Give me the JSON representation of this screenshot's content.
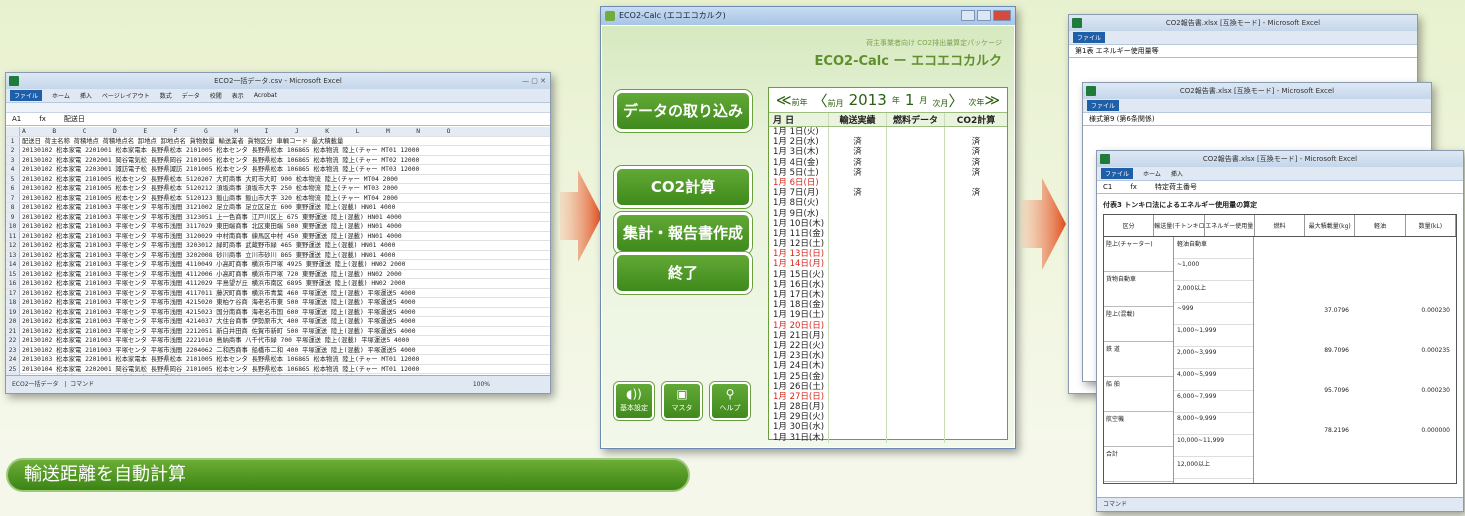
{
  "left_window": {
    "title": "ECO2一括データ.csv - Microsoft Excel",
    "ribbon": [
      "ファイル",
      "ホーム",
      "挿入",
      "ページレイアウト",
      "数式",
      "データ",
      "校閲",
      "表示",
      "Acrobat"
    ],
    "cell_ref": "A1",
    "formula": "配送日",
    "rows": [
      "配送日 荷主名称 荷積地点 荷積地点名 卸地点 卸地点名 貨物数量 輸送業者 貨物区分 車輌コード 最大積載量",
      "20130102 松本家電 2201001 松本家電本 長野県松本 2101005 松本センタ 長野県松本 106865 松本物流 陸上(チャー MT01 12000",
      "20130102 松本家電 2202001 岡谷電気松 長野県岡谷 2101005 松本センタ 長野県松本 106865 松本物流 陸上(チャー MT02 12000",
      "20130102 松本家電 2203001 諏訪電子松 長野県諏訪 2101005 松本センタ 長野県松本 106865 松本物流 陸上(チャー MT03 12000",
      "20130102 松本家電 2101005 松本センタ 長野県松本 5120207 大町商事 大町市大町 900 松本物流 陸上(チャー MT04 2000",
      "20130102 松本家電 2101005 松本センタ 長野県松本 5120212 須坂商事 須坂市大字 250 松本物流 陸上(チャー MT03 2000",
      "20130102 松本家電 2101005 松本センタ 長野県松本 5120123 飯山商事 飯山市大字 320 松本物流 陸上(チャー MT04 2000",
      "20130102 松本家電 2101003 平塚センタ 平塚市浅間 3121002 足立商事 足立区足立 600 東野運送 陸上(混載) HN01 4000",
      "20130102 松本家電 2101003 平塚センタ 平塚市浅間 3123051 上一色商事 江戸川区上 675 東野運送 陸上(混載) HN01 4000",
      "20130102 松本家電 2101003 平塚センタ 平塚市浅間 3117029 東田端商事 北区東田端 500 東野運送 陸上(混載) HN01 4000",
      "20130102 松本家電 2101003 平塚センタ 平塚市浅間 3120029 中村南商事 練馬区中村 450 東野運送 陸上(混載) HN01 4000",
      "20130102 松本家電 2101003 平塚センタ 平塚市浅間 3203012 緑町商事 武蔵野市緑 465 東野運送 陸上(混載) HN01 4000",
      "20130102 松本家電 2101003 平塚センタ 平塚市浅間 3202008 砂川商事 立川市砂川 865 東野運送 陸上(混載) HN01 4000",
      "20130102 松本家電 2101003 平塚センタ 平塚市浅間 4110049 小高町商事 横浜市戸塚 4925 東野運送 陸上(混載) HN02 2000",
      "20130102 松本家電 2101003 平塚センタ 平塚市浅間 4112006 小高町商事 横浜市戸塚 720 東野運送 陸上(混載) HN02 2000",
      "20130102 松本家電 2101003 平塚センタ 平塚市浅間 4112029 平島望が丘 横浜市南区 6895 東野運送 陸上(混載) HN02 2000",
      "20130102 松本家電 2101003 平塚センタ 平塚市浅間 4117011 藤沢町商事 横浜市青葉 460 平塚運送 陸上(混載) 平塚運送5 4000",
      "20130102 松本家電 2101003 平塚センタ 平塚市浅間 4215020 東柏ケ谷商 海老名市東 500 平塚運送 陸上(混載) 平塚運送5 4000",
      "20130102 松本家電 2101003 平塚センタ 平塚市浅間 4215023 国分南商事 海老名市国 600 平塚運送 陸上(混載) 平塚運送5 4000",
      "20130102 松本家電 2101003 平塚センタ 平塚市浅間 4214037 大住台商事 伊勢原市大 400 平塚運送 陸上(混載) 平塚運送5 4000",
      "20130102 松本家電 2101003 平塚センタ 平塚市浅間 2212051 新白井田商 佐賀市新町 500 平塚運送 陸上(混載) 平塚運送5 4000",
      "20130102 松本家電 2101003 平塚センタ 平塚市浅間 2221010 島納商事 八千代市緑 700 平塚運送 陸上(混載) 平塚運送5 4000",
      "20130102 松本家電 2101003 平塚センタ 平塚市浅間 2204062 二和西商事 船橋市二和 400 平塚運送 陸上(混載) 平塚運送5 4000",
      "20130103 松本家電 2201001 松本家電本 長野県松本 2101005 松本センタ 長野県松本 106865 松本物流 陸上(チャー MT01 12000",
      "20130104 松本家電 2202001 岡谷電気松 長野県岡谷 2101005 松本センタ 長野県松本 106865 松本物流 陸上(チャー MT01 12000",
      "20130105 松本家電 2201001 松本家電本 長野県松本 2101005 松本センタ 長野県松本 106865 松本物流 陸上(チャー MT01 12000"
    ],
    "sheet_tab": "ECO2一括データ",
    "status": "コマンド",
    "zoom": "100%"
  },
  "app": {
    "title": "ECO2-Calc (エコエコカルク)",
    "subtitle": "荷主事業者向け CO2排出量算定パッケージ",
    "heading": "ECO2-Calc ー エコエコカルク",
    "menu": [
      "データの取り込み",
      "CO2計算",
      "集計・報告書作成",
      "終了"
    ],
    "small_buttons": [
      {
        "label": "基本設定",
        "icon": "speaker-icon"
      },
      {
        "label": "マスタ",
        "icon": "camera-icon"
      },
      {
        "label": "ヘルプ",
        "icon": "magnifier-icon"
      }
    ],
    "nav": {
      "prev_year": "前年",
      "prev_month": "前月",
      "year": "2013",
      "year_unit": "年",
      "month": "1",
      "month_unit": "月",
      "next_month": "次月",
      "next_year": "次年"
    },
    "columns": [
      "月 日",
      "輸送実績",
      "燃料データ",
      "CO2計算"
    ],
    "days": [
      {
        "d": "1月 1日(火)",
        "a": "",
        "b": "",
        "c": "",
        "red": false
      },
      {
        "d": "1月 2日(水)",
        "a": "済",
        "b": "",
        "c": "済",
        "red": false
      },
      {
        "d": "1月 3日(木)",
        "a": "済",
        "b": "",
        "c": "済",
        "red": false
      },
      {
        "d": "1月 4日(金)",
        "a": "済",
        "b": "",
        "c": "済",
        "red": false
      },
      {
        "d": "1月 5日(土)",
        "a": "済",
        "b": "",
        "c": "済",
        "red": false
      },
      {
        "d": "1月 6日(日)",
        "a": "",
        "b": "",
        "c": "",
        "red": true
      },
      {
        "d": "1月 7日(月)",
        "a": "済",
        "b": "",
        "c": "済",
        "red": false
      },
      {
        "d": "1月 8日(火)",
        "a": "",
        "b": "",
        "c": "",
        "red": false
      },
      {
        "d": "1月 9日(水)",
        "a": "",
        "b": "",
        "c": "",
        "red": false
      },
      {
        "d": "1月 10日(木)",
        "a": "",
        "b": "",
        "c": "",
        "red": false
      },
      {
        "d": "1月 11日(金)",
        "a": "",
        "b": "",
        "c": "",
        "red": false
      },
      {
        "d": "1月 12日(土)",
        "a": "",
        "b": "",
        "c": "",
        "red": false
      },
      {
        "d": "1月 13日(日)",
        "a": "",
        "b": "",
        "c": "",
        "red": true
      },
      {
        "d": "1月 14日(月)",
        "a": "",
        "b": "",
        "c": "",
        "red": true
      },
      {
        "d": "1月 15日(火)",
        "a": "",
        "b": "",
        "c": "",
        "red": false
      },
      {
        "d": "1月 16日(水)",
        "a": "",
        "b": "",
        "c": "",
        "red": false
      },
      {
        "d": "1月 17日(木)",
        "a": "",
        "b": "",
        "c": "",
        "red": false
      },
      {
        "d": "1月 18日(金)",
        "a": "",
        "b": "",
        "c": "",
        "red": false
      },
      {
        "d": "1月 19日(土)",
        "a": "",
        "b": "",
        "c": "",
        "red": false
      },
      {
        "d": "1月 20日(日)",
        "a": "",
        "b": "",
        "c": "",
        "red": true
      },
      {
        "d": "1月 21日(月)",
        "a": "",
        "b": "",
        "c": "",
        "red": false
      },
      {
        "d": "1月 22日(火)",
        "a": "",
        "b": "",
        "c": "",
        "red": false
      },
      {
        "d": "1月 23日(水)",
        "a": "",
        "b": "",
        "c": "",
        "red": false
      },
      {
        "d": "1月 24日(木)",
        "a": "",
        "b": "",
        "c": "",
        "red": false
      },
      {
        "d": "1月 25日(金)",
        "a": "",
        "b": "",
        "c": "",
        "red": false
      },
      {
        "d": "1月 26日(土)",
        "a": "",
        "b": "",
        "c": "",
        "red": false
      },
      {
        "d": "1月 27日(日)",
        "a": "",
        "b": "",
        "c": "",
        "red": true
      },
      {
        "d": "1月 28日(月)",
        "a": "",
        "b": "",
        "c": "",
        "red": false
      },
      {
        "d": "1月 29日(火)",
        "a": "",
        "b": "",
        "c": "",
        "red": false
      },
      {
        "d": "1月 30日(水)",
        "a": "",
        "b": "",
        "c": "",
        "red": false
      },
      {
        "d": "1月 31日(木)",
        "a": "",
        "b": "",
        "c": "",
        "red": false
      }
    ]
  },
  "right_windows": {
    "back_title": "CO2報告書.xlsx [互換モード] - Microsoft Excel",
    "back_cell": "第1表 エネルギー使用量等",
    "mid_title": "CO2報告書.xlsx [互換モード] - Microsoft Excel",
    "mid_cell": "様式第9 (第6条関係)",
    "front_title": "CO2報告書.xlsx [互換モード] - Microsoft Excel",
    "front_ref": "C1",
    "front_formula": "特定荷主番号",
    "front_sheet_title": "付表3 トンキロ法によるエネルギー使用量の算定",
    "headers": [
      "区分",
      "輸送量(千トンキロ)",
      "エネルギー使用量",
      "燃料",
      "最大積載量(kg)",
      "軽油",
      "数量(kL)"
    ],
    "labels": [
      "陸上(チャーター)",
      "貨物自動車",
      "陸上(混載)",
      "鉄 道",
      "船 舶",
      "航空機",
      "合計"
    ],
    "ranges": [
      "軽油自動車",
      "~1,000",
      "2,000以上",
      "~999",
      "1,000~1,999",
      "2,000~3,999",
      "4,000~5,999",
      "6,000~7,999",
      "8,000~9,999",
      "10,000~11,999",
      "12,000以上"
    ],
    "values": [
      "37.0796",
      "0.000230",
      "89.7096",
      "0.000235",
      "95.7096",
      "0.000230",
      "78.2196",
      "0.000000"
    ]
  },
  "banner": "輸送距離を自動計算"
}
